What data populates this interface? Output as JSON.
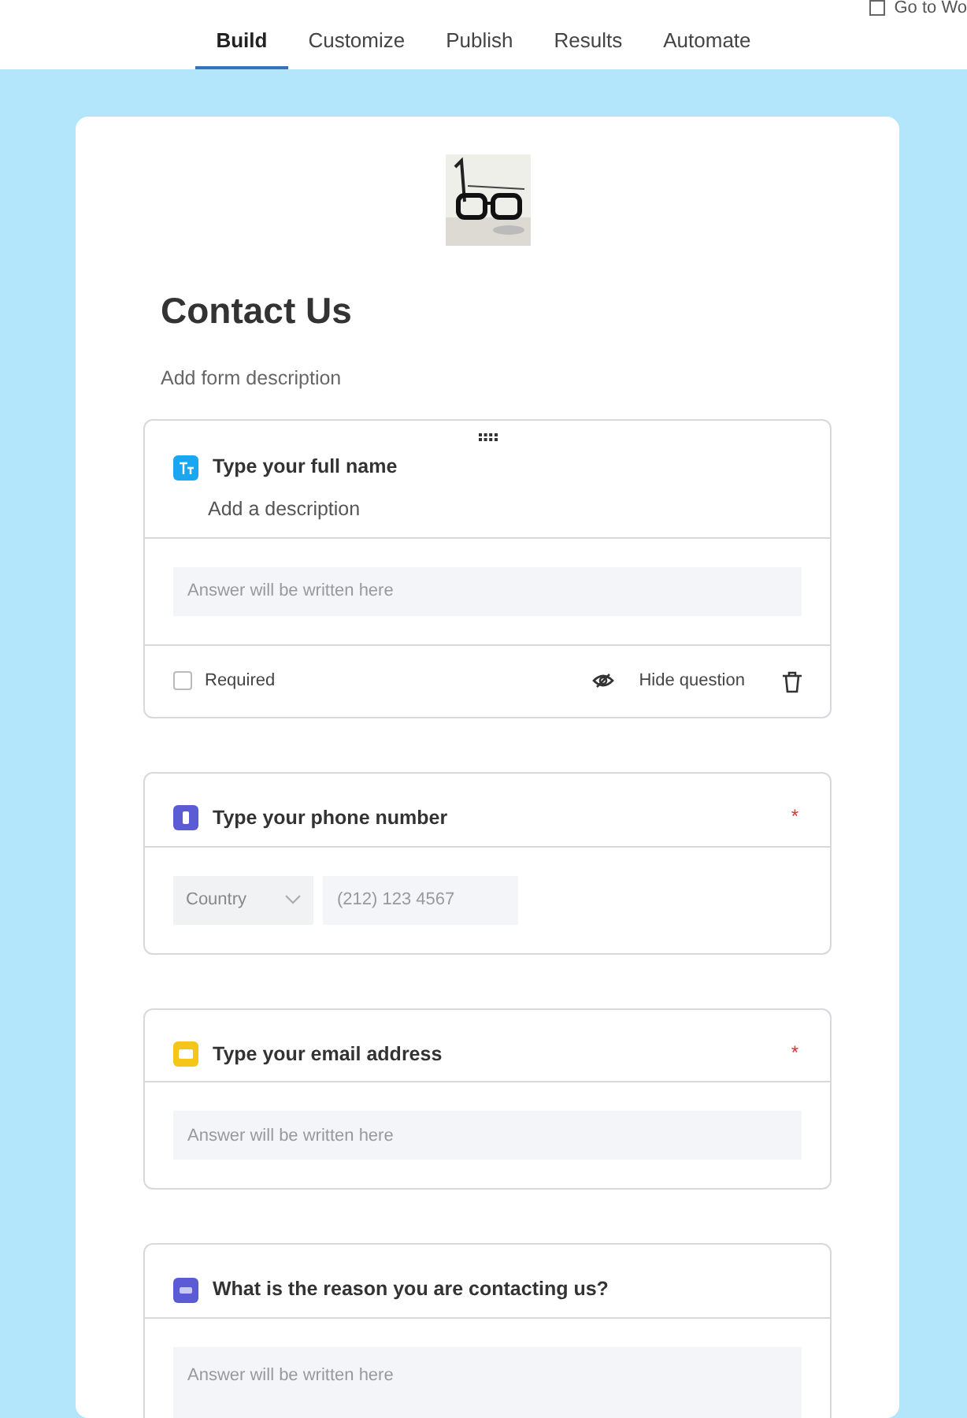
{
  "header": {
    "tabs": [
      {
        "label": "Build",
        "selected": true
      },
      {
        "label": "Customize",
        "selected": false
      },
      {
        "label": "Publish",
        "selected": false
      },
      {
        "label": "Results",
        "selected": false
      },
      {
        "label": "Automate",
        "selected": false
      }
    ],
    "go_to": "Go to Wo"
  },
  "form": {
    "title": "Contact Us",
    "description_placeholder": "Add form description",
    "questions": [
      {
        "kind": "text",
        "title": "Type your full name",
        "expanded": true,
        "required": false,
        "description_placeholder": "Add a description",
        "placeholder": "Answer will be written here",
        "required_label": "Required",
        "hide_label": "Hide question"
      },
      {
        "kind": "phone",
        "title": "Type your phone number",
        "expanded": false,
        "required": true,
        "required_mark": "*",
        "country_placeholder": "Country",
        "placeholder": "(212) 123 4567"
      },
      {
        "kind": "email",
        "title": "Type your email address",
        "expanded": false,
        "required": true,
        "required_mark": "*",
        "placeholder": "Answer will be written here"
      },
      {
        "kind": "longtext",
        "title": "What is the reason you are contacting us?",
        "expanded": false,
        "required": false,
        "placeholder": "Answer will be written here"
      }
    ]
  }
}
